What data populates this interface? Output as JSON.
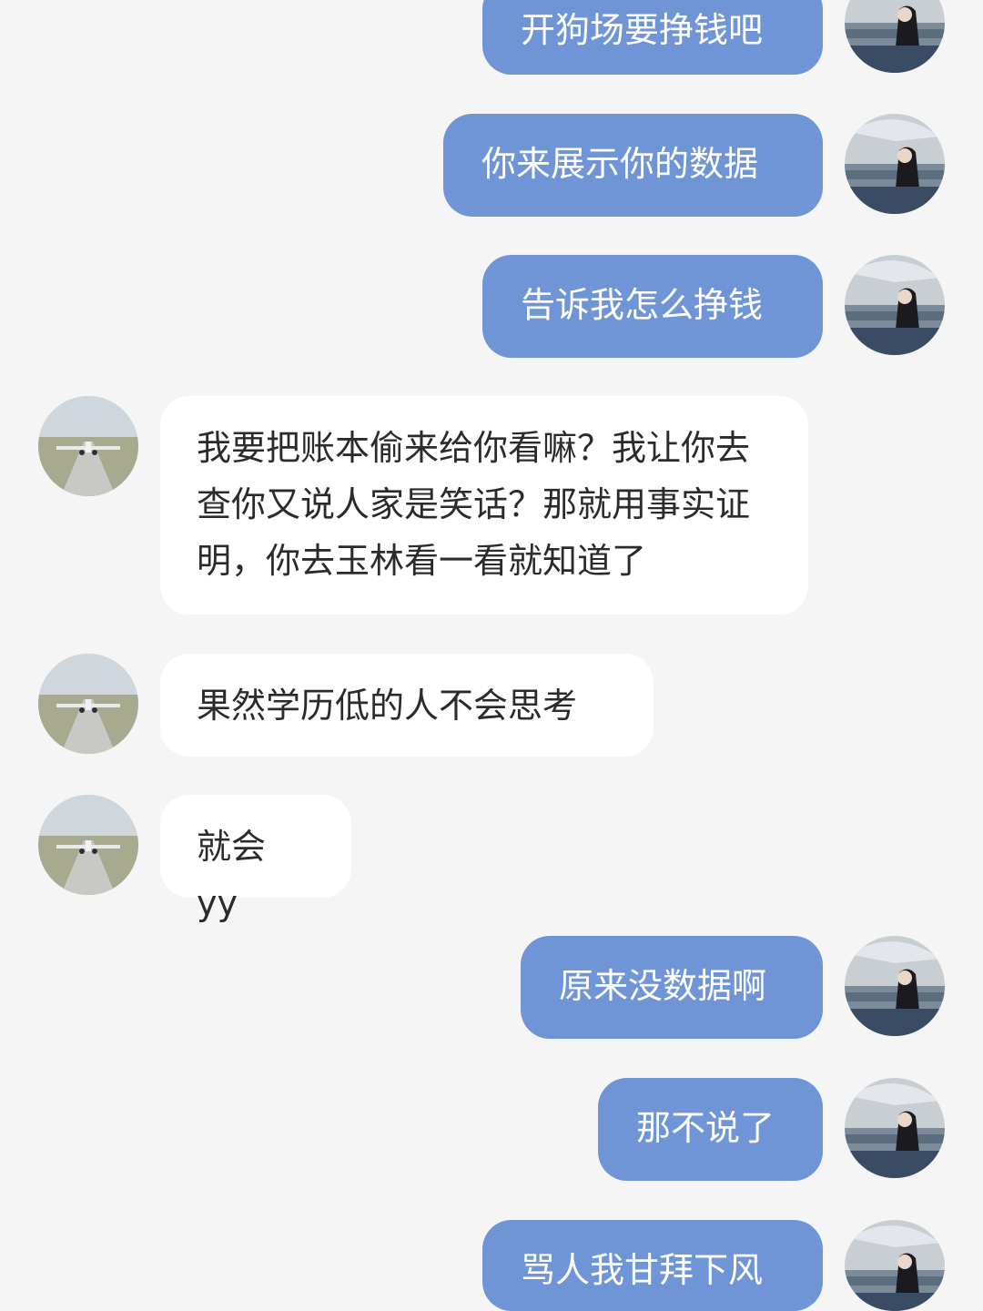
{
  "messages": [
    {
      "side": "out",
      "text": "开狗场要挣钱吧"
    },
    {
      "side": "out",
      "text": "你来展示你的数据"
    },
    {
      "side": "out",
      "text": "告诉我怎么挣钱"
    },
    {
      "side": "in",
      "text": "我要把账本偷来给你看嘛？我让你去查你又说人家是笑话？那就用事实证明，你去玉林看一看就知道了"
    },
    {
      "side": "in",
      "text": "果然学历低的人不会思考"
    },
    {
      "side": "in",
      "text": "就会 yy"
    },
    {
      "side": "out",
      "text": "原来没数据啊"
    },
    {
      "side": "out",
      "text": "那不说了"
    },
    {
      "side": "out",
      "text": "骂人我甘拜下风"
    }
  ],
  "colors": {
    "background": "#f5f5f5",
    "outgoing_bubble": "#6f95d6",
    "incoming_bubble": "#ffffff"
  },
  "icons": {
    "self_avatar": "girl-with-umbrella-photo",
    "peer_avatar": "airplane-runway-photo"
  }
}
